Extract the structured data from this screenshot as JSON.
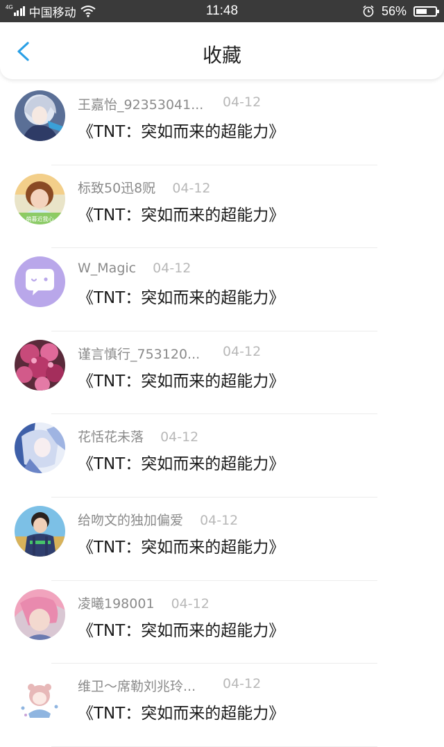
{
  "status_bar": {
    "network": "4G",
    "carrier": "中国移动",
    "time": "11:48",
    "battery_percent": "56%",
    "battery_level": 0.56
  },
  "header": {
    "title": "收藏",
    "back_icon": "chevron-left-icon",
    "accent_color": "#2aa0e6"
  },
  "items": [
    {
      "user": "王嘉怡_92353041...",
      "date": "04-12",
      "title": "《TNT：突如而来的超能力》",
      "avatar": "anime-girl-avatar"
    },
    {
      "user": "标致50迅8贶",
      "date": "04-12",
      "title": "《TNT：突如而来的超能力》",
      "avatar": "girl-photo-avatar",
      "avatar_text": "萌暮近我心"
    },
    {
      "user": "W_Magic",
      "date": "04-12",
      "title": "《TNT：突如而来的超能力》",
      "avatar": "chat-bubble-avatar",
      "avatar_color": "#b9a7ea"
    },
    {
      "user": "谨言慎行_753120...",
      "date": "04-12",
      "title": "《TNT：突如而来的超能力》",
      "avatar": "flowers-avatar"
    },
    {
      "user": "花恬花未落",
      "date": "04-12",
      "title": "《TNT：突如而来的超能力》",
      "avatar": "anime-blue-avatar"
    },
    {
      "user": "给吻文的独加偏爱",
      "date": "04-12",
      "title": "《TNT：突如而来的超能力》",
      "avatar": "boy-photo-avatar"
    },
    {
      "user": "凌曦198001",
      "date": "04-12",
      "title": "《TNT：突如而来的超能力》",
      "avatar": "pink-hair-avatar"
    },
    {
      "user": "维卫～席勒刘兆玲...",
      "date": "04-12",
      "title": "《TNT：突如而来的超能力》",
      "avatar": "cartoon-girl-avatar"
    }
  ]
}
